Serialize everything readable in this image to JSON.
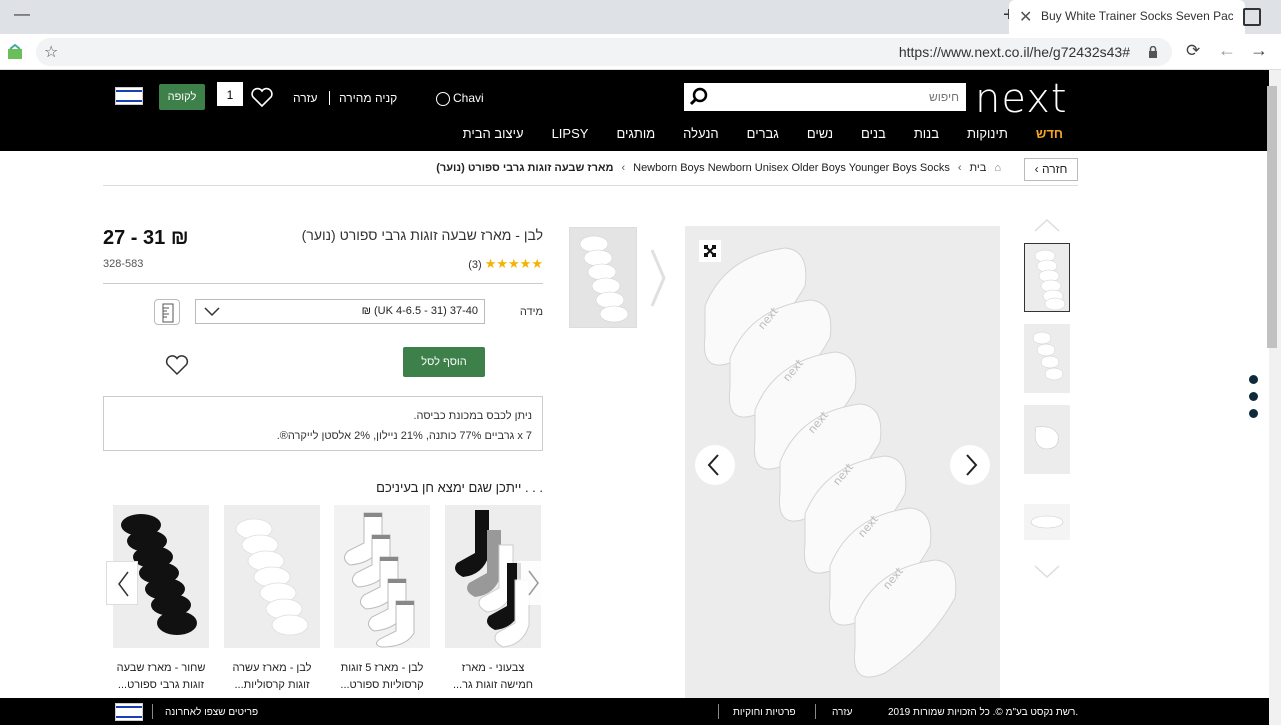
{
  "browser": {
    "tab_title": "Buy White Trainer Socks Seven Pack",
    "url": "https://www.next.co.il/he/g72432s43#"
  },
  "header": {
    "logo": "next",
    "search_placeholder": "חיפוש",
    "user": "Chavi",
    "quick_buy": "קניה מהירה",
    "help": "עזרה",
    "bag_count": "1",
    "checkout": "לקופה",
    "nav": [
      "חדש",
      "תינוקות",
      "בנות",
      "בנים",
      "נשים",
      "גברים",
      "הנעלה",
      "מותגים",
      "LIPSY",
      "עיצוב הבית"
    ]
  },
  "breadcrumb": {
    "back": "חזרה",
    "home": "בית",
    "path": "Newborn Boys Newborn Unisex Older Boys Younger Boys Socks",
    "current": "מארז שבעה זוגות גרבי ספורט (נוער)"
  },
  "product": {
    "title": "לבן - מארז שבעה זוגות גרבי ספורט (נוער)",
    "price": "27 - 31 ₪",
    "rating_count": "(3)",
    "rating_value": 5,
    "code": "328-583",
    "size_label": "מידה",
    "size_value": "37-40 (31 - UK 4-6.5) ₪",
    "add_to_bag": "הוסף לסל",
    "care_line1": "ניתן לכבס במכונת כביסה.",
    "care_line2": "7 x גרביים 77% כותנה, 21% ניילון, 2% אלסטן לייקרה®."
  },
  "recommendations": {
    "title": "ייתכן שגם ימצא חן בעיניכם . . .",
    "items": [
      {
        "line1": "צבעוני - מארז",
        "line2": "חמישה זוגות גר..."
      },
      {
        "line1": "לבן - מארז 5 זוגות",
        "line2": "קרסוליות ספורט..."
      },
      {
        "line1": "לבן - מארז עשרה",
        "line2": "זוגות קרסוליות..."
      },
      {
        "line1": "שחור - מארז שבעה",
        "line2": "זוגות גרבי ספורט..."
      }
    ]
  },
  "footer": {
    "recently_viewed": "פריטים שצפו לאחרונה",
    "privacy": "פרטיות וחוקיות",
    "help": "עזרה",
    "copyright": "2019 רשת נקסט בע\"מ ©. כל הזכויות שמורות."
  },
  "colors": {
    "header_bg": "#000000",
    "accent_green": "#3d8049",
    "nav_highlight": "#f5a623",
    "star": "#f5b301"
  }
}
